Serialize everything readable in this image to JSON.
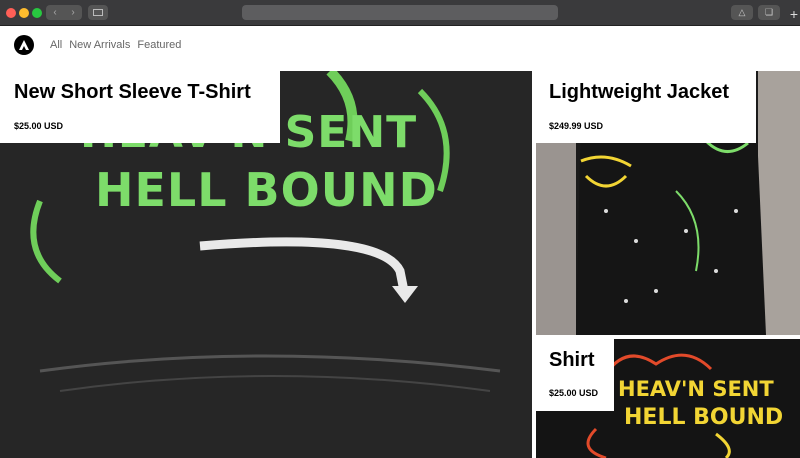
{
  "browser": {
    "back_icon": "chevron-left-icon",
    "forward_icon": "chevron-right-icon",
    "sidebar_icon": "sidebar-icon",
    "share_icon": "share-icon",
    "tabs_icon": "tabs-icon",
    "new_tab_icon": "plus-icon"
  },
  "nav": {
    "logo_icon": "triangle-logo-icon",
    "links": [
      "All",
      "New Arrivals",
      "Featured"
    ]
  },
  "products": [
    {
      "title": "New Short Sleeve T-Shirt",
      "price": "$25.00 USD"
    },
    {
      "title": "Lightweight Jacket",
      "price": "$249.99 USD"
    },
    {
      "title": "Shirt",
      "price": "$25.00 USD"
    }
  ],
  "artwork": {
    "line1": "HEAV'N SENT",
    "line2": "HELL BOUND"
  },
  "colors": {
    "accent_green": "#7ddc6a",
    "shirt_dark": "#2a2a2a",
    "art_yellow": "#f2d534",
    "art_red": "#e24a2a"
  }
}
